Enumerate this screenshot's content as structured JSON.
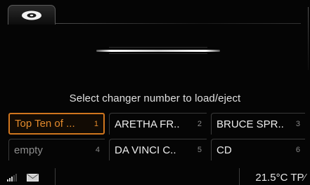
{
  "tab": {
    "icon": "disc-icon"
  },
  "slot_graphic": {
    "icon": "disc-slot-icon"
  },
  "prompt": "Select changer number to load/eject",
  "changers": [
    {
      "label": "Top Ten of ...",
      "number": "1",
      "state": "selected"
    },
    {
      "label": "ARETHA FR..",
      "number": "2",
      "state": "loaded"
    },
    {
      "label": "BRUCE SPR..",
      "number": "3",
      "state": "loaded"
    },
    {
      "label": "empty",
      "number": "4",
      "state": "empty"
    },
    {
      "label": "DA VINCI C..",
      "number": "5",
      "state": "loaded"
    },
    {
      "label": "CD",
      "number": "6",
      "state": "loaded"
    }
  ],
  "status": {
    "signal_icon": "signal-strength-icon",
    "message_icon": "envelope-icon",
    "temperature": "21.5°C",
    "traffic": "TP"
  },
  "colors": {
    "accent": "#d0761e",
    "text": "#e8e8e8",
    "background": "#050505"
  }
}
